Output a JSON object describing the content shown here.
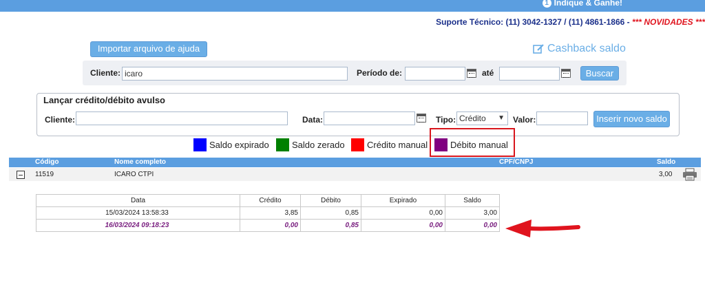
{
  "topbar": {
    "indique_label": "Indique & Ganhe!",
    "indique_icon": "1"
  },
  "support": {
    "text": "Suporte Técnico: (11) 3042-1327 / (11) 4861-1866 - ",
    "novidades": "*** NOVIDADES ***"
  },
  "import_button": "Importar arquivo de ajuda",
  "cashback": {
    "label": "Cashback saldo",
    "icon": "edit-icon"
  },
  "search": {
    "cliente_label": "Cliente:",
    "cliente_value": "icaro",
    "periodo_label": "Período de:",
    "periodo_from": "",
    "ate_label": "até",
    "periodo_to": "",
    "buscar_label": "Buscar"
  },
  "avulso": {
    "title": "Lançar crédito/débito avulso",
    "cliente_label": "Cliente:",
    "cliente_value": "",
    "data_label": "Data:",
    "data_value": "",
    "tipo_label": "Tipo:",
    "tipo_value": "Crédito",
    "valor_label": "Valor:",
    "valor_value": "",
    "insert_button": "Inserir novo saldo"
  },
  "legend": [
    {
      "label": "Saldo expirado",
      "color": "#0000ff"
    },
    {
      "label": "Saldo zerado",
      "color": "#008000"
    },
    {
      "label": "Crédito manual",
      "color": "#ff0000"
    },
    {
      "label": "Débito manual",
      "color": "#800080"
    }
  ],
  "clients_table": {
    "headers": [
      "Código",
      "Nome completo",
      "CPF/CNPJ",
      "Saldo"
    ],
    "row": {
      "codigo": "11519",
      "nome": "ICARO CTPI",
      "cpf": "",
      "saldo": "3,00"
    }
  },
  "detail_table": {
    "headers": [
      "Data",
      "Crédito",
      "Débito",
      "Expirado",
      "Saldo"
    ],
    "rows": [
      {
        "data": "15/03/2024 13:58:33",
        "credito": "3,85",
        "debito": "0,85",
        "expirado": "0,00",
        "saldo": "3,00",
        "style": "normal"
      },
      {
        "data": "16/03/2024 09:18:23",
        "credito": "0,00",
        "debito": "0,85",
        "expirado": "0,00",
        "saldo": "0,00",
        "style": "purple"
      }
    ]
  },
  "colors": {
    "accent": "#5b9ee0",
    "button": "#6aaee6",
    "highlight": "#d8151c",
    "debito": "#7a2080"
  }
}
